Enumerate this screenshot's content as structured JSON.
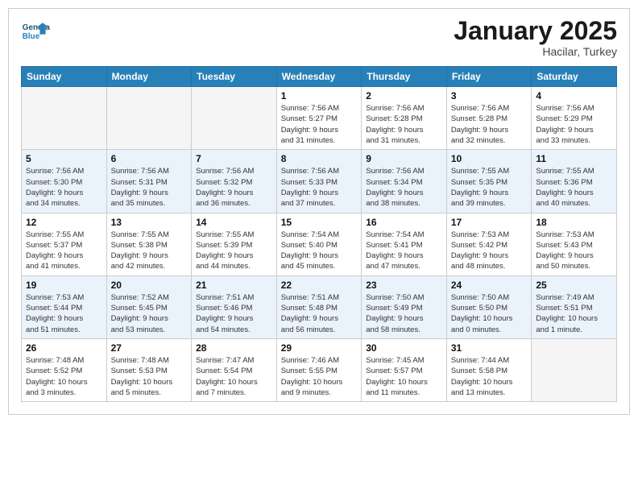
{
  "logo": {
    "line1": "General",
    "line2": "Blue"
  },
  "title": "January 2025",
  "subtitle": "Hacilar, Turkey",
  "headers": [
    "Sunday",
    "Monday",
    "Tuesday",
    "Wednesday",
    "Thursday",
    "Friday",
    "Saturday"
  ],
  "weeks": [
    [
      {
        "day": "",
        "info": ""
      },
      {
        "day": "",
        "info": ""
      },
      {
        "day": "",
        "info": ""
      },
      {
        "day": "1",
        "info": "Sunrise: 7:56 AM\nSunset: 5:27 PM\nDaylight: 9 hours\nand 31 minutes."
      },
      {
        "day": "2",
        "info": "Sunrise: 7:56 AM\nSunset: 5:28 PM\nDaylight: 9 hours\nand 31 minutes."
      },
      {
        "day": "3",
        "info": "Sunrise: 7:56 AM\nSunset: 5:28 PM\nDaylight: 9 hours\nand 32 minutes."
      },
      {
        "day": "4",
        "info": "Sunrise: 7:56 AM\nSunset: 5:29 PM\nDaylight: 9 hours\nand 33 minutes."
      }
    ],
    [
      {
        "day": "5",
        "info": "Sunrise: 7:56 AM\nSunset: 5:30 PM\nDaylight: 9 hours\nand 34 minutes."
      },
      {
        "day": "6",
        "info": "Sunrise: 7:56 AM\nSunset: 5:31 PM\nDaylight: 9 hours\nand 35 minutes."
      },
      {
        "day": "7",
        "info": "Sunrise: 7:56 AM\nSunset: 5:32 PM\nDaylight: 9 hours\nand 36 minutes."
      },
      {
        "day": "8",
        "info": "Sunrise: 7:56 AM\nSunset: 5:33 PM\nDaylight: 9 hours\nand 37 minutes."
      },
      {
        "day": "9",
        "info": "Sunrise: 7:56 AM\nSunset: 5:34 PM\nDaylight: 9 hours\nand 38 minutes."
      },
      {
        "day": "10",
        "info": "Sunrise: 7:55 AM\nSunset: 5:35 PM\nDaylight: 9 hours\nand 39 minutes."
      },
      {
        "day": "11",
        "info": "Sunrise: 7:55 AM\nSunset: 5:36 PM\nDaylight: 9 hours\nand 40 minutes."
      }
    ],
    [
      {
        "day": "12",
        "info": "Sunrise: 7:55 AM\nSunset: 5:37 PM\nDaylight: 9 hours\nand 41 minutes."
      },
      {
        "day": "13",
        "info": "Sunrise: 7:55 AM\nSunset: 5:38 PM\nDaylight: 9 hours\nand 42 minutes."
      },
      {
        "day": "14",
        "info": "Sunrise: 7:55 AM\nSunset: 5:39 PM\nDaylight: 9 hours\nand 44 minutes."
      },
      {
        "day": "15",
        "info": "Sunrise: 7:54 AM\nSunset: 5:40 PM\nDaylight: 9 hours\nand 45 minutes."
      },
      {
        "day": "16",
        "info": "Sunrise: 7:54 AM\nSunset: 5:41 PM\nDaylight: 9 hours\nand 47 minutes."
      },
      {
        "day": "17",
        "info": "Sunrise: 7:53 AM\nSunset: 5:42 PM\nDaylight: 9 hours\nand 48 minutes."
      },
      {
        "day": "18",
        "info": "Sunrise: 7:53 AM\nSunset: 5:43 PM\nDaylight: 9 hours\nand 50 minutes."
      }
    ],
    [
      {
        "day": "19",
        "info": "Sunrise: 7:53 AM\nSunset: 5:44 PM\nDaylight: 9 hours\nand 51 minutes."
      },
      {
        "day": "20",
        "info": "Sunrise: 7:52 AM\nSunset: 5:45 PM\nDaylight: 9 hours\nand 53 minutes."
      },
      {
        "day": "21",
        "info": "Sunrise: 7:51 AM\nSunset: 5:46 PM\nDaylight: 9 hours\nand 54 minutes."
      },
      {
        "day": "22",
        "info": "Sunrise: 7:51 AM\nSunset: 5:48 PM\nDaylight: 9 hours\nand 56 minutes."
      },
      {
        "day": "23",
        "info": "Sunrise: 7:50 AM\nSunset: 5:49 PM\nDaylight: 9 hours\nand 58 minutes."
      },
      {
        "day": "24",
        "info": "Sunrise: 7:50 AM\nSunset: 5:50 PM\nDaylight: 10 hours\nand 0 minutes."
      },
      {
        "day": "25",
        "info": "Sunrise: 7:49 AM\nSunset: 5:51 PM\nDaylight: 10 hours\nand 1 minute."
      }
    ],
    [
      {
        "day": "26",
        "info": "Sunrise: 7:48 AM\nSunset: 5:52 PM\nDaylight: 10 hours\nand 3 minutes."
      },
      {
        "day": "27",
        "info": "Sunrise: 7:48 AM\nSunset: 5:53 PM\nDaylight: 10 hours\nand 5 minutes."
      },
      {
        "day": "28",
        "info": "Sunrise: 7:47 AM\nSunset: 5:54 PM\nDaylight: 10 hours\nand 7 minutes."
      },
      {
        "day": "29",
        "info": "Sunrise: 7:46 AM\nSunset: 5:55 PM\nDaylight: 10 hours\nand 9 minutes."
      },
      {
        "day": "30",
        "info": "Sunrise: 7:45 AM\nSunset: 5:57 PM\nDaylight: 10 hours\nand 11 minutes."
      },
      {
        "day": "31",
        "info": "Sunrise: 7:44 AM\nSunset: 5:58 PM\nDaylight: 10 hours\nand 13 minutes."
      },
      {
        "day": "",
        "info": ""
      }
    ]
  ]
}
